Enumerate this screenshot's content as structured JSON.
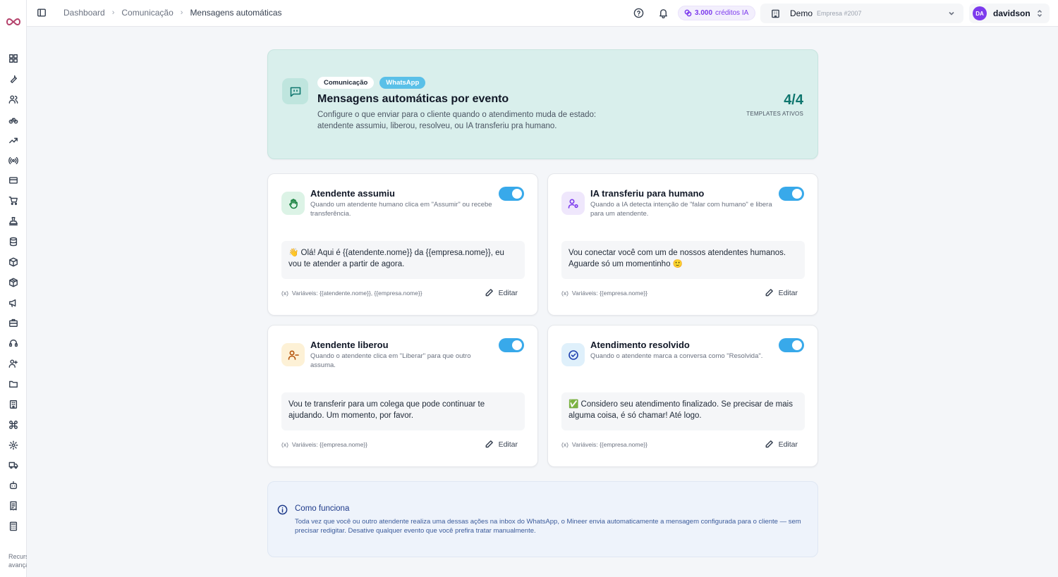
{
  "sidebar": {
    "logo": "mineer-infinity-logo",
    "icons": [
      "dashboard-icon",
      "wrench-icon",
      "users-icon",
      "bicycle-icon",
      "trending-up-icon",
      "broadcast-icon",
      "credit-card-icon",
      "cart-icon",
      "stamp-icon",
      "database-icon",
      "box-icon",
      "package-icon",
      "megaphone-icon",
      "briefcase-icon",
      "headset-icon",
      "user-group-icon",
      "folder-icon",
      "building-icon",
      "command-icon",
      "settings-icon",
      "truck-icon",
      "bot-icon",
      "receipt-icon",
      "calculator-icon"
    ],
    "footer": "Recursos avançados"
  },
  "header": {
    "breadcrumb": [
      "Dashboard",
      "Comunicação",
      "Mensagens automáticas"
    ],
    "credits_amount": "3.000",
    "credits_label": "créditos IA",
    "company_name": "Demo",
    "company_id": "Empresa #2007",
    "user_initials": "DA",
    "user_name": "davidson"
  },
  "hero": {
    "chip_category": "Comunicação",
    "chip_channel": "WhatsApp",
    "title": "Mensagens automáticas por evento",
    "description": "Configure o que enviar para o cliente quando o atendimento muda de estado: atendente assumiu, liberou, resolveu, ou IA transferiu pra humano.",
    "count": "4/4",
    "count_label": "TEMPLATES ATIVOS"
  },
  "cards": [
    {
      "title": "Atendente assumiu",
      "subtitle": "Quando um atendente humano clica em \"Assumir\" ou recebe transferência.",
      "message": "👋 Olá! Aqui é {{atendente.nome}} da {{empresa.nome}}, eu vou te atender a partir de agora.",
      "vars": "Variáveis: {{atendente.nome}}, {{empresa.nome}}",
      "edit": "Editar",
      "enabled": true
    },
    {
      "title": "IA transferiu para humano",
      "subtitle": "Quando a IA detecta intenção de \"falar com humano\" e libera para um atendente.",
      "message": "Vou conectar você com um de nossos atendentes humanos. Aguarde só um momentinho 🙂",
      "vars": "Variáveis: {{empresa.nome}}",
      "edit": "Editar",
      "enabled": true
    },
    {
      "title": "Atendente liberou",
      "subtitle": "Quando o atendente clica em \"Liberar\" para que outro assuma.",
      "message": "Vou te transferir para um colega que pode continuar te ajudando. Um momento, por favor.",
      "vars": "Variáveis: {{empresa.nome}}",
      "edit": "Editar",
      "enabled": true
    },
    {
      "title": "Atendimento resolvido",
      "subtitle": "Quando o atendente marca a conversa como \"Resolvida\".",
      "message": "✅ Considero seu atendimento finalizado. Se precisar de mais alguma coisa, é só chamar! Até logo.",
      "vars": "Variáveis: {{empresa.nome}}",
      "edit": "Editar",
      "enabled": true
    }
  ],
  "info": {
    "title": "Como funciona",
    "text": "Toda vez que você ou outro atendente realiza uma dessas ações na inbox do WhatsApp, o Mineer envia automaticamente a mensagem configurada para o cliente — sem precisar redigitar. Desative qualquer evento que você prefira tratar manualmente."
  },
  "colors": {
    "accent": "#38a9ea",
    "hero_bg": "#d9efec",
    "teal": "#0f766e",
    "purple": "#7c3aed",
    "info_bg": "#eef3fb"
  }
}
